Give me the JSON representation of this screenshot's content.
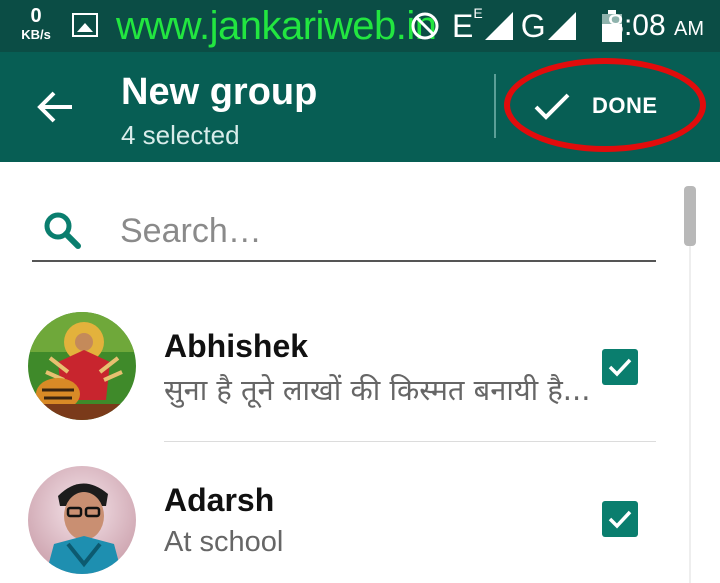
{
  "status_bar": {
    "speed_value": "0",
    "speed_unit": "KB/s",
    "watermark": "www.jankariweb.in",
    "network_e": "E",
    "network_e_sup": "E",
    "network_g": "G",
    "time": "8:08",
    "ampm": "AM",
    "icons": [
      "gallery-icon",
      "no-entry-icon",
      "signal-icon",
      "battery-icon"
    ]
  },
  "app_bar": {
    "title": "New group",
    "subtitle": "4 selected",
    "done_label": "DONE",
    "icons": [
      "back-arrow-icon",
      "check-icon"
    ]
  },
  "search": {
    "placeholder": "Search…",
    "value": ""
  },
  "contacts": [
    {
      "name": "Abhishek",
      "status": "सुना है तूने लाखों की किस्मत बनायी है...",
      "checked": true
    },
    {
      "name": "Adarsh",
      "status": "At school",
      "checked": true
    }
  ],
  "colors": {
    "status_bar": "#0b4d45",
    "app_bar": "#075e54",
    "accent": "#0a7e6e",
    "watermark": "#22e640",
    "annotation": "#e10c0c"
  }
}
